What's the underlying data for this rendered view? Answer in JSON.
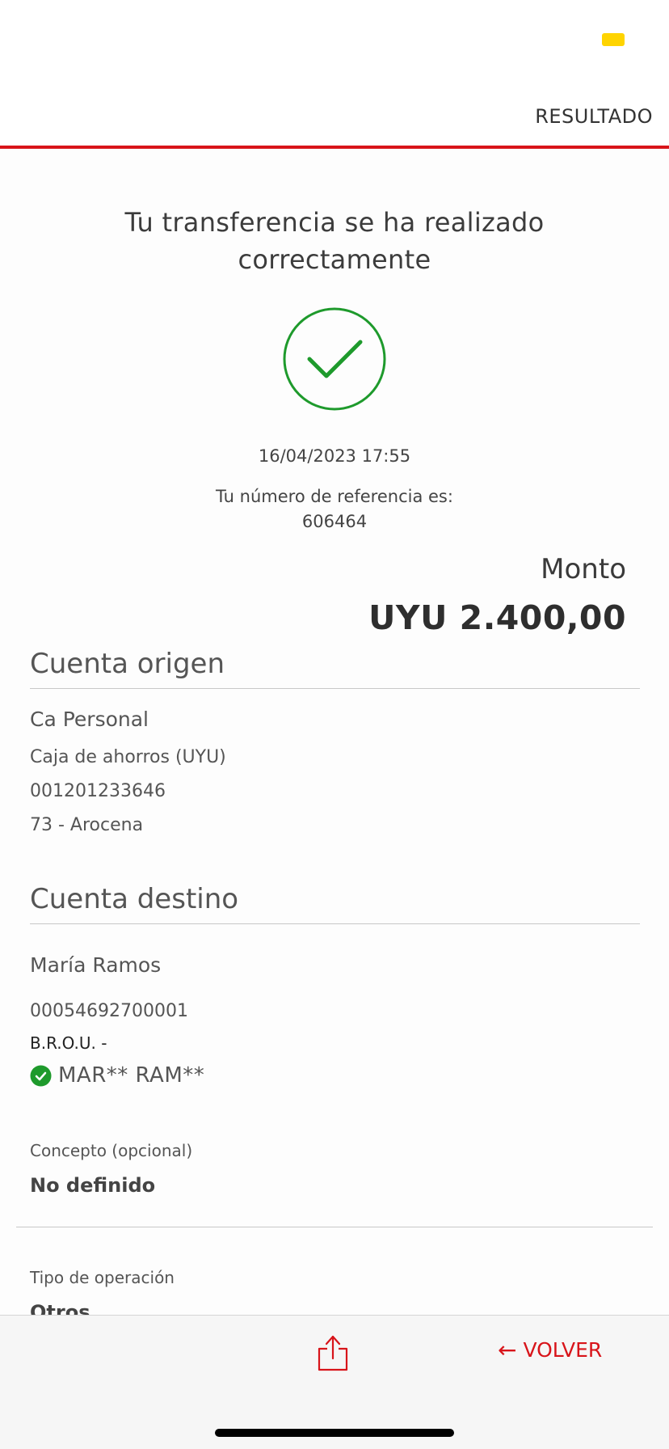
{
  "header": {
    "title": "RESULTADO"
  },
  "result": {
    "message": "Tu transferencia se ha realizado correctamente",
    "datetime": "16/04/2023 17:55",
    "reference_label": "Tu número de referencia es:",
    "reference_number": "606464",
    "amount_label": "Monto",
    "amount_value": "UYU 2.400,00"
  },
  "origin": {
    "title": "Cuenta origen",
    "name": "Ca Personal",
    "type": "Caja de ahorros (UYU)",
    "account_number": "001201233646",
    "branch": "73 - Arocena"
  },
  "destination": {
    "title": "Cuenta destino",
    "name": "María Ramos",
    "account_number": "00054692700001",
    "bank": "B.R.O.U. -",
    "verified_name": "MAR** RAM**"
  },
  "concept": {
    "label": "Concepto (opcional)",
    "value": "No definido"
  },
  "operation": {
    "label": "Tipo de operación",
    "value": "Otros"
  },
  "actions": {
    "share_icon": "share-icon",
    "back_label": "VOLVER",
    "back_icon": "arrow-left-icon"
  },
  "colors": {
    "accent": "#d8141a",
    "success": "#1e9a2c",
    "battery": "#ffd400"
  }
}
